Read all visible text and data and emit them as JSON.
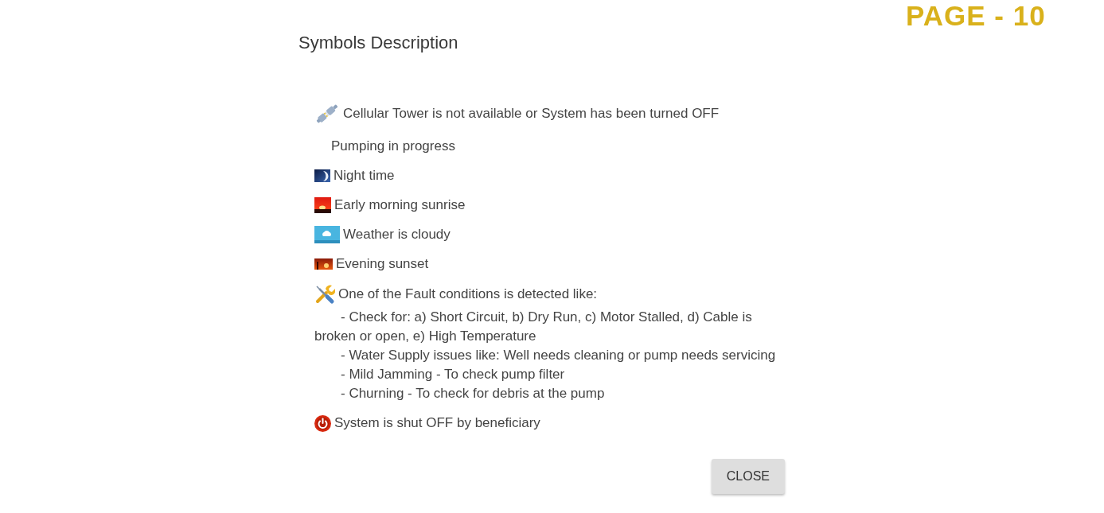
{
  "page_label": "PAGE - 10",
  "dialog": {
    "title": "Symbols Description",
    "items": [
      {
        "kind": "disconnected",
        "text": "Cellular Tower is not available or System has been turned OFF"
      },
      {
        "kind": "pumping",
        "text": "Pumping in progress"
      },
      {
        "kind": "night",
        "text": "Night time"
      },
      {
        "kind": "sunrise",
        "text": "Early morning sunrise"
      },
      {
        "kind": "cloudy",
        "text": "Weather is cloudy"
      },
      {
        "kind": "sunset",
        "text": "Evening sunset"
      },
      {
        "kind": "fault",
        "text": "One of the Fault conditions is detected like:",
        "details": [
          "- Check for: a) Short Circuit, b) Dry Run, c) Motor Stalled, d) Cable is broken or open, e) High Temperature",
          "- Water Supply issues like: Well needs cleaning or pump needs servicing",
          "- Mild Jamming - To check pump filter",
          "- Churning - To check for debris at the pump"
        ]
      },
      {
        "kind": "shutoff",
        "text": "System is shut OFF by beneficiary"
      }
    ],
    "buttons": [
      {
        "label": "CLOSE"
      }
    ]
  }
}
